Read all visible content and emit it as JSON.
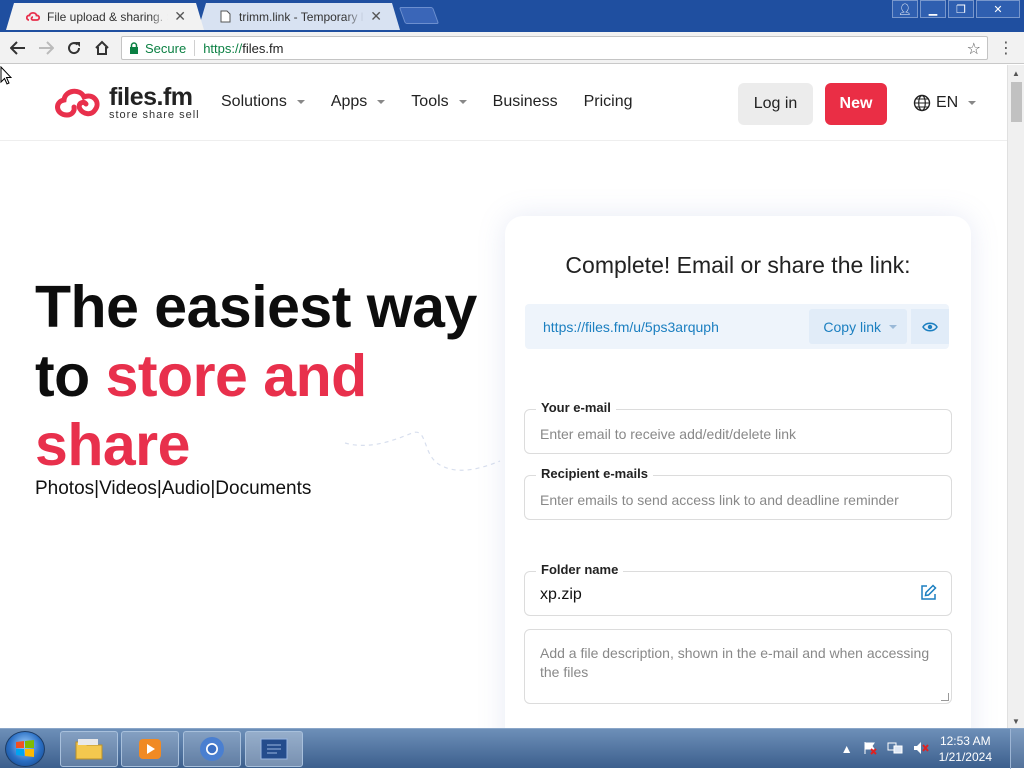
{
  "browser": {
    "tabs": [
      {
        "title": "File upload & sharing. Se",
        "active": true
      },
      {
        "title": "trimm.link - Temporary l",
        "active": false
      }
    ],
    "secure_label": "Secure",
    "url_scheme": "https://",
    "url_host": "files.fm"
  },
  "site": {
    "logo_name": "files.fm",
    "logo_tagline": "store share sell",
    "nav": [
      {
        "label": "Solutions",
        "dropdown": true
      },
      {
        "label": "Apps",
        "dropdown": true
      },
      {
        "label": "Tools",
        "dropdown": true
      },
      {
        "label": "Business",
        "dropdown": false
      },
      {
        "label": "Pricing",
        "dropdown": false
      }
    ],
    "login_label": "Log in",
    "new_label": "New",
    "language": "EN",
    "accent_color": "#e8304c"
  },
  "hero": {
    "line1": "The easiest way",
    "line2_prefix": "to ",
    "line2_accent": "store and",
    "line3_accent": "share",
    "subtitle": "Photos|Videos|Audio|Documents"
  },
  "share_card": {
    "title": "Complete! Email or share the link:",
    "link": "https://files.fm/u/5ps3arquph",
    "copy_label": "Copy link",
    "your_email_label": "Your e-mail",
    "your_email_placeholder": "Enter email to receive add/edit/delete link",
    "recipient_label": "Recipient e-mails",
    "recipient_placeholder": "Enter emails to send access link to and deadline reminder",
    "folder_label": "Folder name",
    "folder_value": "xp.zip",
    "description_placeholder": "Add a file description, shown in the e-mail and when accessing the files"
  },
  "taskbar": {
    "time": "12:53 AM",
    "date": "1/21/2024"
  }
}
